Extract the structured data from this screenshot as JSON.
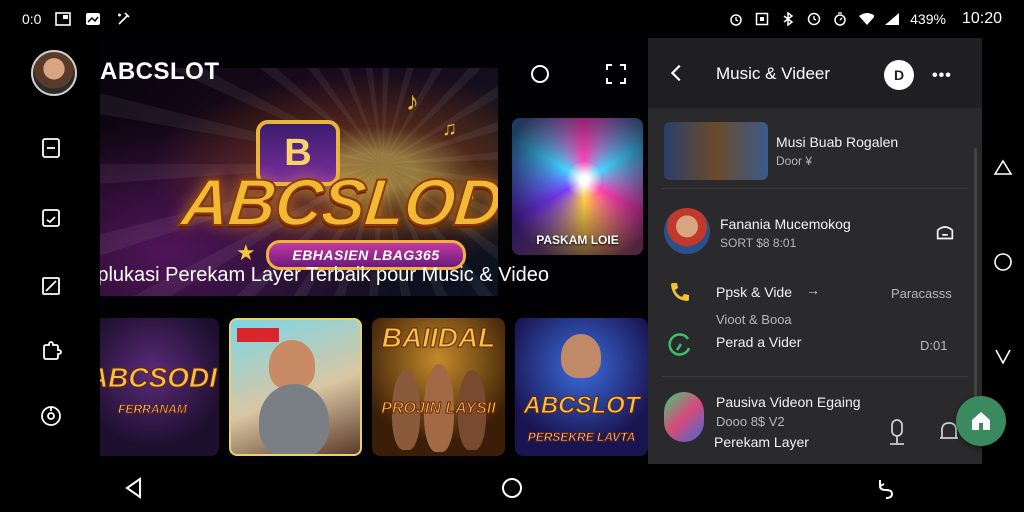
{
  "status_bar": {
    "left_text": "0:0",
    "battery": "439%",
    "time": "10:20",
    "icons": [
      "gallery-icon",
      "image-icon",
      "wand-icon",
      "alarm-icon",
      "nfc-icon",
      "bluetooth-icon",
      "clock-icon",
      "timer-icon",
      "wifi-icon",
      "signal-icon"
    ]
  },
  "app": {
    "title": "ABCSLOT",
    "hero": {
      "badge_letter": "B",
      "logo_text": "ABCSLODT",
      "ribbon_text": "EBHASIEN LBAG365"
    },
    "feature_card_caption": "PASKAM LOIE",
    "headline": "Aplukasi Perekam Layer Terbaik pour Music & Video",
    "tiles": [
      {
        "title": "ABCSODI",
        "subtitle": "FERRANAM"
      },
      {
        "title": "",
        "subtitle": ""
      },
      {
        "title": "BAIIDAL",
        "subtitle": "PROJIN LAYSII"
      },
      {
        "title": "ABCSLOT",
        "subtitle": "PERSEKRE LAVTA"
      }
    ]
  },
  "panel": {
    "title": "Music & Videer",
    "circle_button_label": "D",
    "items": [
      {
        "title": "Musi Buab Rogalen",
        "subtitle": "Door ¥"
      },
      {
        "title": "Fanania Mucemokog",
        "subtitle": "SORT   $8 8:01"
      },
      {
        "title": "Ppsk & Vide",
        "arrow": "→",
        "right_text": "Paracasss",
        "subtitle": "Vioot & Booa"
      },
      {
        "title": "Perad a Vider",
        "right_text": "D:01"
      },
      {
        "title": "Pausiva Videon Egaing",
        "subtitle": "Dooo 8$ V2",
        "subtitle2": "Perekam Layer"
      }
    ]
  },
  "colors": {
    "panel_bg": "#2a2a2c",
    "accent_green": "#3b8a5f",
    "logo_gold": "#f2b935"
  }
}
